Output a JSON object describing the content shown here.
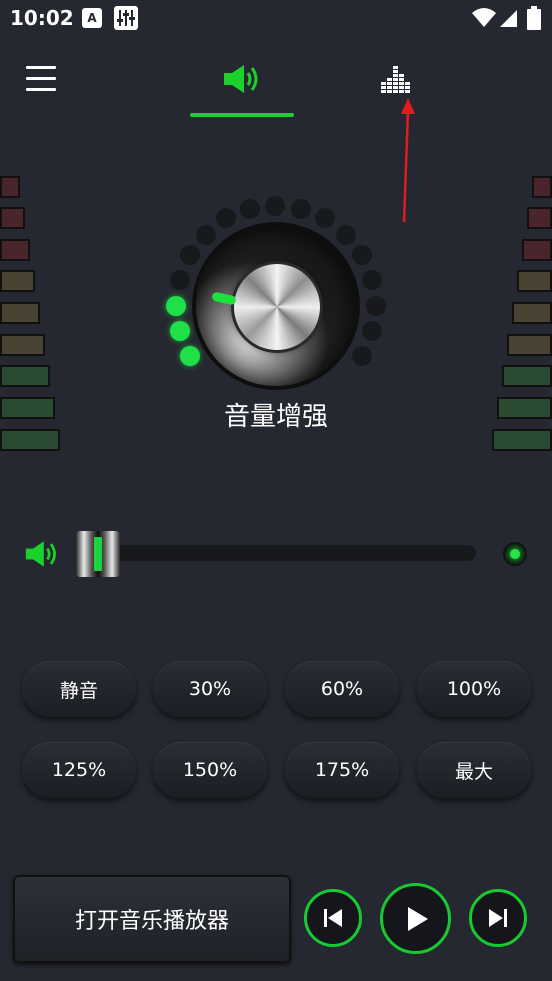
{
  "status_bar": {
    "time": "10:02",
    "icon_a": "A"
  },
  "header": {
    "menu_icon": "hamburger-menu-icon",
    "tabs": [
      {
        "name": "volume",
        "icon": "speaker-icon",
        "active": true
      },
      {
        "name": "equalizer",
        "icon": "equalizer-icon",
        "active": false
      }
    ]
  },
  "colors": {
    "accent": "#1bd22c",
    "background": "#252830",
    "annotation_arrow": "#e11d1d"
  },
  "knob": {
    "label": "音量增强",
    "level_fraction": 0.18
  },
  "slider": {
    "value_fraction": 0.0
  },
  "presets": [
    "静音",
    "30%",
    "60%",
    "100%",
    "125%",
    "150%",
    "175%",
    "最大"
  ],
  "footer": {
    "open_player_label": "打开音乐播放器"
  }
}
